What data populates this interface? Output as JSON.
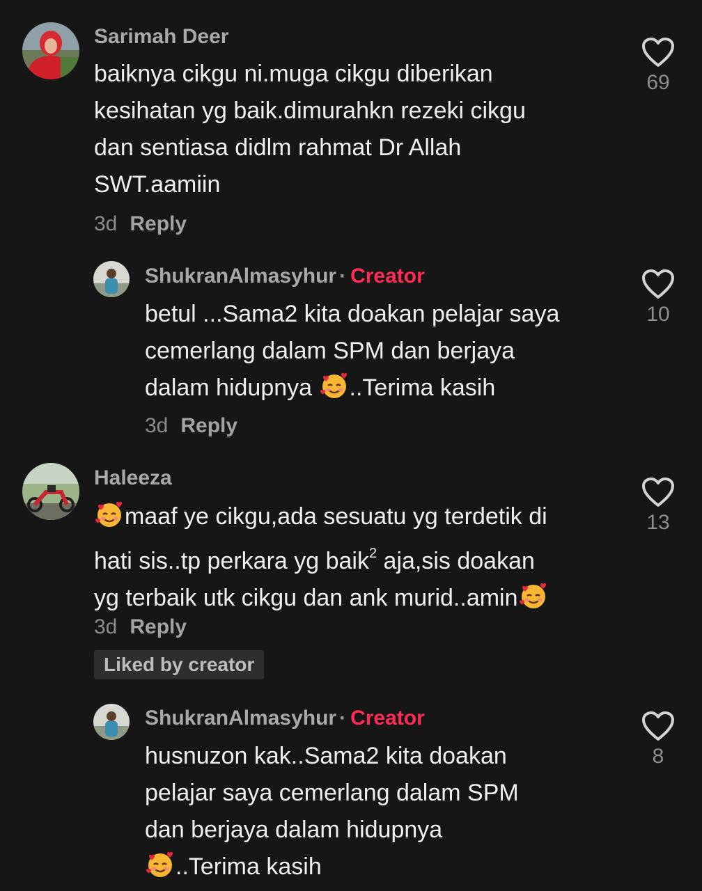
{
  "comments": [
    {
      "username": "Sarimah Deer",
      "lines": [
        "baiknya cikgu ni.muga cikgu diberikan",
        "kesihatan yg baik.dimurahkn rezeki cikgu",
        "dan sentiasa didlm rahmat Dr Allah",
        "SWT.aamiin"
      ],
      "time": "3d",
      "reply_label": "Reply",
      "likes": "69"
    },
    {
      "username": "ShukranAlmasyhur",
      "separator": "·",
      "badge": "Creator",
      "lines": [
        "betul ...Sama2 kita doakan pelajar saya",
        "cemerlang dalam SPM dan berjaya"
      ],
      "line3_prefix": "dalam hidupnya ",
      "line3_suffix": "..Terima kasih",
      "time": "3d",
      "reply_label": "Reply",
      "likes": "10"
    },
    {
      "username": "Haleeza",
      "line1": "maaf ye cikgu,ada sesuatu yg terdetik di",
      "line2_prefix": "hati sis..tp perkara yg baik",
      "line2_sup": "2",
      "line2_suffix": " aja,sis doakan",
      "line3": "yg terbaik utk cikgu dan ank murid..amin",
      "time": "3d",
      "reply_label": "Reply",
      "liked_by": "Liked by creator",
      "likes": "13"
    },
    {
      "username": "ShukranAlmasyhur",
      "separator": "·",
      "badge": "Creator",
      "lines": [
        "husnuzon kak..Sama2 kita doakan",
        "pelajar saya cemerlang dalam SPM",
        "dan berjaya dalam hidupnya"
      ],
      "line4_suffix": "..Terima kasih",
      "likes": "8"
    }
  ],
  "icons": {
    "like": "heart-outline-icon",
    "emoji": "smiling-face-with-hearts-emoji"
  },
  "colors": {
    "background": "#161616",
    "creator": "#fe2c55"
  }
}
